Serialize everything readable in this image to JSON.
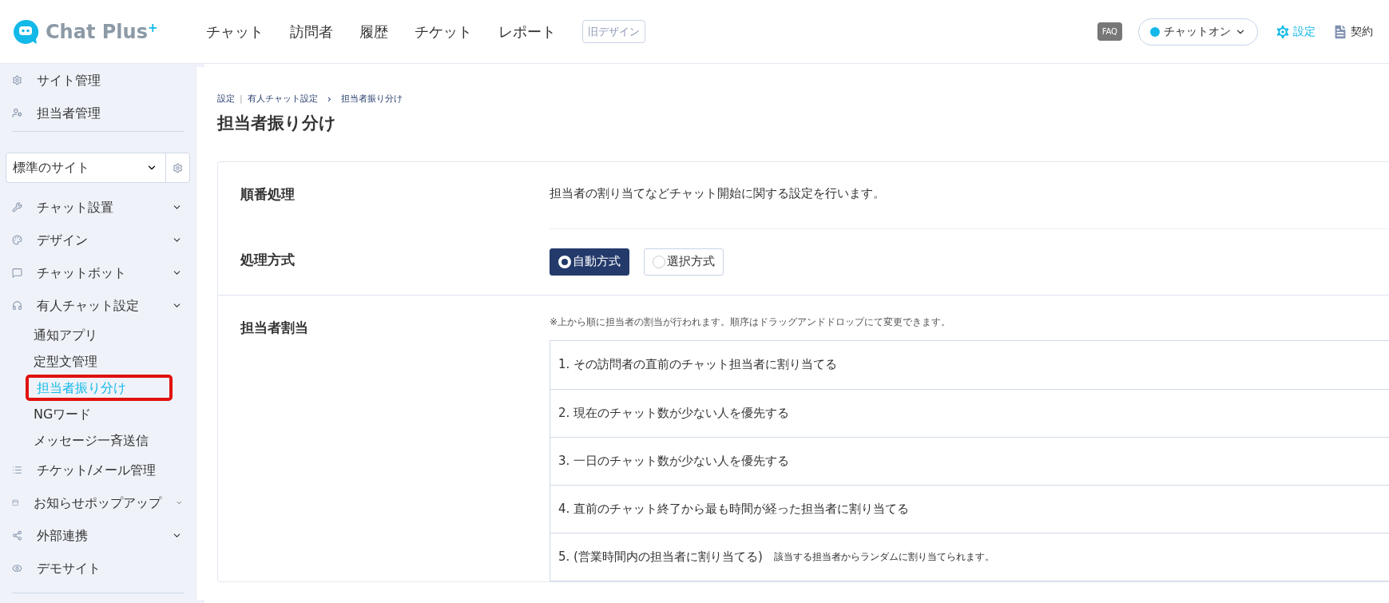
{
  "header": {
    "logo_text": "Chat Plus",
    "logo_sup": "+",
    "nav": [
      "チャット",
      "訪問者",
      "履歴",
      "チケット",
      "レポート"
    ],
    "old_design_button": "旧デザイン",
    "faq": "FAQ",
    "status": {
      "label": "チャットオン",
      "on": true
    },
    "settings": "設定",
    "contract": "契約"
  },
  "sidebar": {
    "top_items": [
      "サイト管理",
      "担当者管理"
    ],
    "site_select": "標準のサイト",
    "menu": [
      {
        "label": "チャット設置",
        "expandable": true
      },
      {
        "label": "デザイン",
        "expandable": true
      },
      {
        "label": "チャットボット",
        "expandable": true
      },
      {
        "label": "有人チャット設定",
        "expandable": true,
        "children": [
          {
            "label": "通知アプリ",
            "selected": false
          },
          {
            "label": "定型文管理",
            "selected": false
          },
          {
            "label": "担当者振り分け",
            "selected": true
          },
          {
            "label": "NGワード",
            "selected": false
          },
          {
            "label": "メッセージ一斉送信",
            "selected": false
          }
        ]
      },
      {
        "label": "チケット/メール管理",
        "expandable": false
      },
      {
        "label": "お知らせポップアップ",
        "expandable": true
      },
      {
        "label": "外部連携",
        "expandable": true
      },
      {
        "label": "デモサイト",
        "expandable": false
      }
    ]
  },
  "main": {
    "breadcrumb": [
      {
        "kind": "link",
        "text": "設定"
      },
      {
        "kind": "separator",
        "text": "|"
      },
      {
        "kind": "link",
        "text": "有人チャット設定"
      },
      {
        "kind": "arrow",
        "text": "›"
      },
      {
        "kind": "link",
        "text": "担当者振り分け"
      }
    ],
    "title": "担当者振り分け",
    "sections": [
      {
        "kind": "text",
        "label": "順番処理",
        "text": "担当者の割り当てなどチャット開始に関する設定を行います。"
      },
      {
        "kind": "radio",
        "label": "処理方式",
        "options": [
          {
            "label": "自動方式",
            "selected": true
          },
          {
            "label": "選択方式",
            "selected": false
          }
        ]
      },
      {
        "kind": "list",
        "label": "担当者割当",
        "note": "※上から順に担当者の割当が行われます。順序はドラッグアンドドロップにて変更できます。",
        "items": [
          {
            "text": "1. その訪問者の直前のチャット担当者に割り当てる"
          },
          {
            "text": "2. 現在のチャット数が少ない人を優先する"
          },
          {
            "text": "3. 一日のチャット数が少ない人を優先する"
          },
          {
            "text": "4. 直前のチャット終了から最も時間が経った担当者に割り当てる"
          },
          {
            "text": "5. (営業時間内の担当者に割り当てる)",
            "note": "該当する担当者からランダムに割り当てられます。"
          }
        ]
      }
    ]
  }
}
